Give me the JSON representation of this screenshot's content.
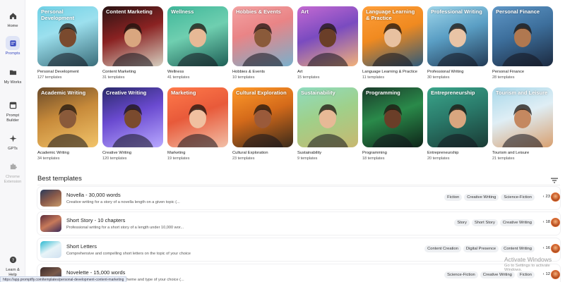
{
  "sidebar": {
    "items": [
      {
        "label": "Home",
        "icon": "home-icon"
      },
      {
        "label": "Prompts",
        "icon": "prompts-icon"
      },
      {
        "label": "My Works",
        "icon": "folder-icon"
      },
      {
        "label": "Prompt Builder",
        "icon": "builder-icon"
      },
      {
        "label": "GPTs",
        "icon": "sparkle-icon"
      },
      {
        "label": "Chrome Extension",
        "icon": "puzzle-icon"
      },
      {
        "label": "Learn & Help",
        "icon": "help-icon"
      }
    ]
  },
  "categories": [
    {
      "title": "Personal Development",
      "name": "Personal Development",
      "count": "127 templates"
    },
    {
      "title": "Content Marketing",
      "name": "Content Marketing",
      "count": "31 templates"
    },
    {
      "title": "Wellness",
      "name": "Wellness",
      "count": "41 templates"
    },
    {
      "title": "Hobbies & Events",
      "name": "Hobbies & Events",
      "count": "10 templates"
    },
    {
      "title": "Art",
      "name": "Art",
      "count": "15 templates"
    },
    {
      "title": "Language Learning & Practice",
      "name": "Language Learning & Practice",
      "count": "11 templates"
    },
    {
      "title": "Professional Writing",
      "name": "Professional Writing",
      "count": "30 templates"
    },
    {
      "title": "Personal Finance",
      "name": "Personal Finance",
      "count": "28 templates"
    },
    {
      "title": "Academic Writing",
      "name": "Academic Writing",
      "count": "34 templates"
    },
    {
      "title": "Creative Writing",
      "name": "Creative Writing",
      "count": "120 templates"
    },
    {
      "title": "Marketing",
      "name": "Marketing",
      "count": "19 templates"
    },
    {
      "title": "Cultural Exploration",
      "name": "Cultural Exploration",
      "count": "23 templates"
    },
    {
      "title": "Sustainability",
      "name": "Sustainability",
      "count": "9 templates"
    },
    {
      "title": "Programming",
      "name": "Programming",
      "count": "18 templates"
    },
    {
      "title": "Entrepreneurship",
      "name": "Entrepreneurship",
      "count": "20 templates"
    },
    {
      "title": "Tourism and Leisure",
      "name": "Tourism and Leisure",
      "count": "21 templates"
    }
  ],
  "best_templates": {
    "title": "Best templates",
    "rows": [
      {
        "title": "Novella - 30,000 words",
        "desc": "Creative writing for a story of a novella length on a given topic (...",
        "tags": [
          "Fiction",
          "Creative Writing",
          "Science-Fiction"
        ],
        "likes": "23"
      },
      {
        "title": "Short Story - 10 chapters",
        "desc": "Professional writing for a short story of a length under 10,000 wor...",
        "tags": [
          "Story",
          "Short Story",
          "Creative Writing"
        ],
        "likes": "18"
      },
      {
        "title": "Short Letters",
        "desc": "Comprehensive and compelling short letters on the topic of your choice",
        "tags": [
          "Content Creation",
          "Digital Presence",
          "Content Writing"
        ],
        "likes": "16"
      },
      {
        "title": "Novelette - 15,000 words",
        "desc": "Story of a novelette length on the theme and type of your choice (...",
        "tags": [
          "Science-Fiction",
          "Creative Writing",
          "Fiction"
        ],
        "likes": "12"
      }
    ]
  },
  "status_url": "https://app.promptfly.com/templates/personal-development-content-marketing",
  "watermark": {
    "line1": "Activate Windows",
    "line2": "Go to Settings to activate Windows."
  },
  "colors": {
    "accent": "#3b4cc0",
    "active_bg": "#dfe4f6"
  }
}
